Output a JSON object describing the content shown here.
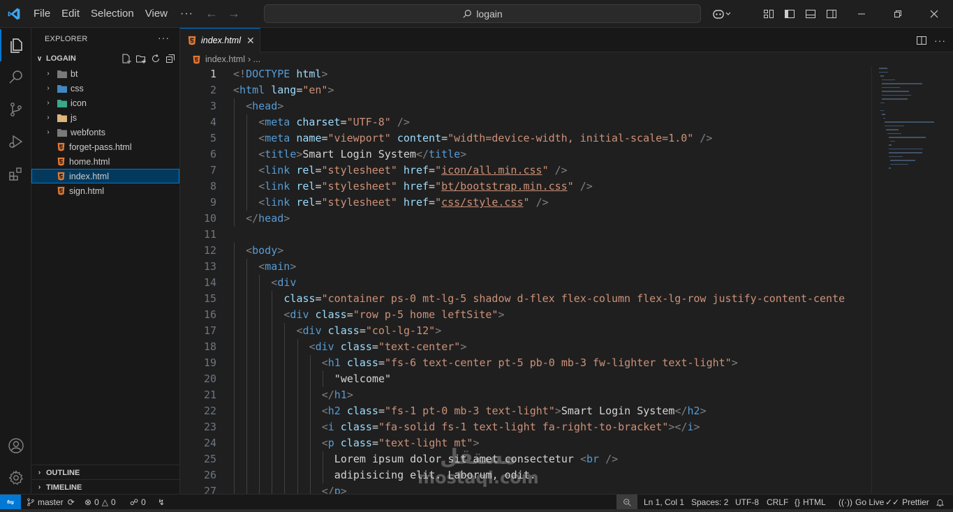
{
  "menu": {
    "file": "File",
    "edit": "Edit",
    "selection": "Selection",
    "view": "View",
    "more": "···"
  },
  "search": {
    "text": "logain"
  },
  "explorer": {
    "title": "EXPLORER",
    "more": "···",
    "folder": "LOGAIN",
    "items": [
      {
        "label": "bt",
        "type": "folder"
      },
      {
        "label": "css",
        "type": "folder"
      },
      {
        "label": "icon",
        "type": "folder"
      },
      {
        "label": "js",
        "type": "folder"
      },
      {
        "label": "webfonts",
        "type": "folder"
      },
      {
        "label": "forget-pass.html",
        "type": "html"
      },
      {
        "label": "home.html",
        "type": "html"
      },
      {
        "label": "index.html",
        "type": "html",
        "selected": true
      },
      {
        "label": "sign.html",
        "type": "html"
      }
    ],
    "outline": "OUTLINE",
    "timeline": "TIMELINE"
  },
  "tab": {
    "label": "index.html",
    "close": "✕"
  },
  "breadcrumb": {
    "file": "index.html",
    "sep": "› ..."
  },
  "code": {
    "current_line": 1,
    "lines": [
      {
        "n": "1",
        "indent": 0,
        "tokens": [
          [
            "brk",
            "<!"
          ],
          [
            "tag",
            "DOCTYPE"
          ],
          [
            "txt",
            " "
          ],
          [
            "attr",
            "html"
          ],
          [
            "brk",
            ">"
          ]
        ]
      },
      {
        "n": "2",
        "indent": 0,
        "tokens": [
          [
            "brk",
            "<"
          ],
          [
            "tag",
            "html"
          ],
          [
            "txt",
            " "
          ],
          [
            "attr",
            "lang"
          ],
          [
            "txt",
            "="
          ],
          [
            "str",
            "\"en\""
          ],
          [
            "brk",
            ">"
          ]
        ]
      },
      {
        "n": "3",
        "indent": 1,
        "tokens": [
          [
            "brk",
            "<"
          ],
          [
            "tag",
            "head"
          ],
          [
            "brk",
            ">"
          ]
        ]
      },
      {
        "n": "4",
        "indent": 2,
        "tokens": [
          [
            "brk",
            "<"
          ],
          [
            "tag",
            "meta"
          ],
          [
            "txt",
            " "
          ],
          [
            "attr",
            "charset"
          ],
          [
            "txt",
            "="
          ],
          [
            "str",
            "\"UTF-8\""
          ],
          [
            "txt",
            " "
          ],
          [
            "brk",
            "/>"
          ]
        ]
      },
      {
        "n": "5",
        "indent": 2,
        "tokens": [
          [
            "brk",
            "<"
          ],
          [
            "tag",
            "meta"
          ],
          [
            "txt",
            " "
          ],
          [
            "attr",
            "name"
          ],
          [
            "txt",
            "="
          ],
          [
            "str",
            "\"viewport\""
          ],
          [
            "txt",
            " "
          ],
          [
            "attr",
            "content"
          ],
          [
            "txt",
            "="
          ],
          [
            "str",
            "\"width=device-width, initial-scale=1.0\""
          ],
          [
            "txt",
            " "
          ],
          [
            "brk",
            "/>"
          ]
        ]
      },
      {
        "n": "6",
        "indent": 2,
        "tokens": [
          [
            "brk",
            "<"
          ],
          [
            "tag",
            "title"
          ],
          [
            "brk",
            ">"
          ],
          [
            "txt",
            "Smart Login System"
          ],
          [
            "brk",
            "</"
          ],
          [
            "tag",
            "title"
          ],
          [
            "brk",
            ">"
          ]
        ]
      },
      {
        "n": "7",
        "indent": 2,
        "tokens": [
          [
            "brk",
            "<"
          ],
          [
            "tag",
            "link"
          ],
          [
            "txt",
            " "
          ],
          [
            "attr",
            "rel"
          ],
          [
            "txt",
            "="
          ],
          [
            "str",
            "\"stylesheet\""
          ],
          [
            "txt",
            " "
          ],
          [
            "attr",
            "href"
          ],
          [
            "txt",
            "="
          ],
          [
            "str",
            "\""
          ],
          [
            "strul",
            "icon/all.min.css"
          ],
          [
            "str",
            "\""
          ],
          [
            "txt",
            " "
          ],
          [
            "brk",
            "/>"
          ]
        ]
      },
      {
        "n": "8",
        "indent": 2,
        "tokens": [
          [
            "brk",
            "<"
          ],
          [
            "tag",
            "link"
          ],
          [
            "txt",
            " "
          ],
          [
            "attr",
            "rel"
          ],
          [
            "txt",
            "="
          ],
          [
            "str",
            "\"stylesheet\""
          ],
          [
            "txt",
            " "
          ],
          [
            "attr",
            "href"
          ],
          [
            "txt",
            "="
          ],
          [
            "str",
            "\""
          ],
          [
            "strul",
            "bt/bootstrap.min.css"
          ],
          [
            "str",
            "\""
          ],
          [
            "txt",
            " "
          ],
          [
            "brk",
            "/>"
          ]
        ]
      },
      {
        "n": "9",
        "indent": 2,
        "tokens": [
          [
            "brk",
            "<"
          ],
          [
            "tag",
            "link"
          ],
          [
            "txt",
            " "
          ],
          [
            "attr",
            "rel"
          ],
          [
            "txt",
            "="
          ],
          [
            "str",
            "\"stylesheet\""
          ],
          [
            "txt",
            " "
          ],
          [
            "attr",
            "href"
          ],
          [
            "txt",
            "="
          ],
          [
            "str",
            "\""
          ],
          [
            "strul",
            "css/style.css"
          ],
          [
            "str",
            "\""
          ],
          [
            "txt",
            " "
          ],
          [
            "brk",
            "/>"
          ]
        ]
      },
      {
        "n": "10",
        "indent": 1,
        "tokens": [
          [
            "brk",
            "</"
          ],
          [
            "tag",
            "head"
          ],
          [
            "brk",
            ">"
          ]
        ]
      },
      {
        "n": "11",
        "indent": 0,
        "tokens": []
      },
      {
        "n": "12",
        "indent": 1,
        "tokens": [
          [
            "brk",
            "<"
          ],
          [
            "tag",
            "body"
          ],
          [
            "brk",
            ">"
          ]
        ]
      },
      {
        "n": "13",
        "indent": 2,
        "tokens": [
          [
            "brk",
            "<"
          ],
          [
            "tag",
            "main"
          ],
          [
            "brk",
            ">"
          ]
        ]
      },
      {
        "n": "14",
        "indent": 3,
        "tokens": [
          [
            "brk",
            "<"
          ],
          [
            "tag",
            "div"
          ]
        ]
      },
      {
        "n": "15",
        "indent": 4,
        "tokens": [
          [
            "attr",
            "class"
          ],
          [
            "txt",
            "="
          ],
          [
            "str",
            "\"container ps-0 mt-lg-5 shadow d-flex flex-column flex-lg-row justify-content-cente"
          ]
        ]
      },
      {
        "n": "16",
        "indent": 4,
        "tokens": [
          [
            "brk",
            "<"
          ],
          [
            "tag",
            "div"
          ],
          [
            "txt",
            " "
          ],
          [
            "attr",
            "class"
          ],
          [
            "txt",
            "="
          ],
          [
            "str",
            "\"row p-5 home leftSite\""
          ],
          [
            "brk",
            ">"
          ]
        ]
      },
      {
        "n": "17",
        "indent": 5,
        "tokens": [
          [
            "brk",
            "<"
          ],
          [
            "tag",
            "div"
          ],
          [
            "txt",
            " "
          ],
          [
            "attr",
            "class"
          ],
          [
            "txt",
            "="
          ],
          [
            "str",
            "\"col-lg-12\""
          ],
          [
            "brk",
            ">"
          ]
        ]
      },
      {
        "n": "18",
        "indent": 6,
        "tokens": [
          [
            "brk",
            "<"
          ],
          [
            "tag",
            "div"
          ],
          [
            "txt",
            " "
          ],
          [
            "attr",
            "class"
          ],
          [
            "txt",
            "="
          ],
          [
            "str",
            "\"text-center\""
          ],
          [
            "brk",
            ">"
          ]
        ]
      },
      {
        "n": "19",
        "indent": 7,
        "tokens": [
          [
            "brk",
            "<"
          ],
          [
            "tag",
            "h1"
          ],
          [
            "txt",
            " "
          ],
          [
            "attr",
            "class"
          ],
          [
            "txt",
            "="
          ],
          [
            "str",
            "\"fs-6 text-center pt-5 pb-0 mb-3 fw-lighter text-light\""
          ],
          [
            "brk",
            ">"
          ]
        ]
      },
      {
        "n": "20",
        "indent": 8,
        "tokens": [
          [
            "txt",
            "\"welcome\""
          ]
        ]
      },
      {
        "n": "21",
        "indent": 7,
        "tokens": [
          [
            "brk",
            "</"
          ],
          [
            "tag",
            "h1"
          ],
          [
            "brk",
            ">"
          ]
        ]
      },
      {
        "n": "22",
        "indent": 7,
        "tokens": [
          [
            "brk",
            "<"
          ],
          [
            "tag",
            "h2"
          ],
          [
            "txt",
            " "
          ],
          [
            "attr",
            "class"
          ],
          [
            "txt",
            "="
          ],
          [
            "str",
            "\"fs-1 pt-0 mb-3 text-light\""
          ],
          [
            "brk",
            ">"
          ],
          [
            "txt",
            "Smart Login System"
          ],
          [
            "brk",
            "</"
          ],
          [
            "tag",
            "h2"
          ],
          [
            "brk",
            ">"
          ]
        ]
      },
      {
        "n": "23",
        "indent": 7,
        "tokens": [
          [
            "brk",
            "<"
          ],
          [
            "tag",
            "i"
          ],
          [
            "txt",
            " "
          ],
          [
            "attr",
            "class"
          ],
          [
            "txt",
            "="
          ],
          [
            "str",
            "\"fa-solid fs-1 text-light fa-right-to-bracket\""
          ],
          [
            "brk",
            "></"
          ],
          [
            "tag",
            "i"
          ],
          [
            "brk",
            ">"
          ]
        ]
      },
      {
        "n": "24",
        "indent": 7,
        "tokens": [
          [
            "brk",
            "<"
          ],
          [
            "tag",
            "p"
          ],
          [
            "txt",
            " "
          ],
          [
            "attr",
            "class"
          ],
          [
            "txt",
            "="
          ],
          [
            "str",
            "\"text-light mt\""
          ],
          [
            "brk",
            ">"
          ]
        ]
      },
      {
        "n": "25",
        "indent": 8,
        "tokens": [
          [
            "txt",
            "Lorem ipsum dolor sit amet consectetur "
          ],
          [
            "brk",
            "<"
          ],
          [
            "tag",
            "br"
          ],
          [
            "txt",
            " "
          ],
          [
            "brk",
            "/>"
          ]
        ]
      },
      {
        "n": "26",
        "indent": 8,
        "tokens": [
          [
            "txt",
            "adipisicing elit. Laborum, odit."
          ]
        ]
      },
      {
        "n": "27",
        "indent": 7,
        "tokens": [
          [
            "brk",
            "</"
          ],
          [
            "tag",
            "p"
          ],
          [
            "brk",
            ">"
          ]
        ]
      }
    ]
  },
  "status": {
    "branch": "master",
    "errors": "0",
    "warnings": "0",
    "ports": "0",
    "position": "Ln 1, Col 1",
    "spaces": "Spaces: 2",
    "encoding": "UTF-8",
    "eol": "CRLF",
    "language": "HTML",
    "golive": "Go Live",
    "prettier": "Prettier"
  },
  "watermark": {
    "arabic": "مستقل",
    "latin": "mostaql.com"
  },
  "colors": {
    "accent": "#0078d4",
    "selection": "#04395e",
    "html_icon": "#e37933",
    "folder_icon": "#dcb67a"
  }
}
